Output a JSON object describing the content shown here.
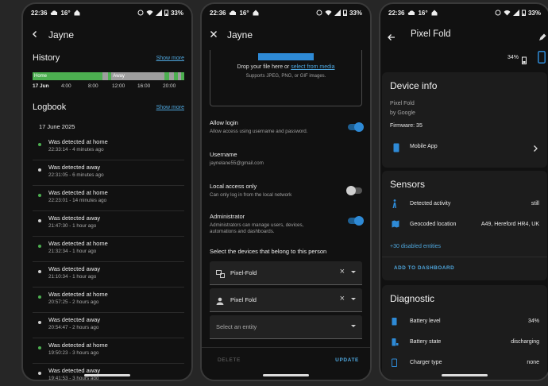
{
  "status": {
    "time": "22:36",
    "temp": "16°",
    "battery": "33%"
  },
  "screen1": {
    "title": "Jayne",
    "history": {
      "title": "History",
      "show_more": "Show more",
      "bar_labels": {
        "home": "Home",
        "away": "Away"
      },
      "ticks": [
        "17 Jun",
        "4:00",
        "8:00",
        "12:00",
        "16:00",
        "20:00"
      ]
    },
    "logbook": {
      "title": "Logbook",
      "show_more": "Show more",
      "date": "17 June 2025",
      "entries": [
        {
          "msg": "Was detected at home",
          "time": "22:33:14 - 4 minutes ago",
          "state": "home"
        },
        {
          "msg": "Was detected away",
          "time": "22:31:05 - 6 minutes ago",
          "state": "away"
        },
        {
          "msg": "Was detected at home",
          "time": "22:23:01 - 14 minutes ago",
          "state": "home"
        },
        {
          "msg": "Was detected away",
          "time": "21:47:30 - 1 hour ago",
          "state": "away"
        },
        {
          "msg": "Was detected at home",
          "time": "21:32:34 - 1 hour ago",
          "state": "home"
        },
        {
          "msg": "Was detected away",
          "time": "21:10:34 - 1 hour ago",
          "state": "away"
        },
        {
          "msg": "Was detected at home",
          "time": "20:57:25 - 2 hours ago",
          "state": "home"
        },
        {
          "msg": "Was detected away",
          "time": "20:54:47 - 2 hours ago",
          "state": "away"
        },
        {
          "msg": "Was detected at home",
          "time": "19:50:23 - 3 hours ago",
          "state": "home"
        },
        {
          "msg": "Was detected away",
          "time": "19:41:53 - 3 hours ago",
          "state": "away"
        }
      ]
    }
  },
  "screen2": {
    "title": "Jayne",
    "upload": {
      "text": "Drop your file here or ",
      "link": "select from media",
      "sub": "Supports JPEG, PNG, or GIF images."
    },
    "allow_login": {
      "title": "Allow login",
      "desc": "Allow access using username and password.",
      "on": true
    },
    "username": {
      "title": "Username",
      "value": "jaynelane55@gmail.com"
    },
    "local_only": {
      "title": "Local access only",
      "desc": "Can only log in from the local network",
      "on": false
    },
    "admin": {
      "title": "Administrator",
      "desc": "Administrators can manage users, devices, automations and dashboards.",
      "on": true
    },
    "devices_label": "Select the devices that belong to this person",
    "devices": [
      "Pixel-Fold",
      "Pixel Fold"
    ],
    "entity_placeholder": "Select an entity",
    "delete": "DELETE",
    "update": "UPDATE"
  },
  "screen3": {
    "title": "Pixel Fold",
    "battery_pct": "34%",
    "device_info": {
      "title": "Device info",
      "model": "Pixel Fold",
      "by": "by Google",
      "firmware": "Firmware: 35",
      "app": "Mobile App"
    },
    "sensors": {
      "title": "Sensors",
      "rows": [
        {
          "k": "Detected activity",
          "v": "still"
        },
        {
          "k": "Geocoded location",
          "v": "A49, Hereford HR4, UK"
        }
      ],
      "disabled": "+30 disabled entities",
      "add": "ADD TO DASHBOARD"
    },
    "diagnostic": {
      "title": "Diagnostic",
      "rows": [
        {
          "k": "Battery level",
          "v": "34%"
        },
        {
          "k": "Battery state",
          "v": "discharging"
        },
        {
          "k": "Charger type",
          "v": "none"
        }
      ]
    }
  },
  "colors": {
    "accent": "#4ea6dd",
    "home": "#4caf50",
    "away": "#9e9e9e",
    "toggle_on": "#2e8ad6"
  }
}
